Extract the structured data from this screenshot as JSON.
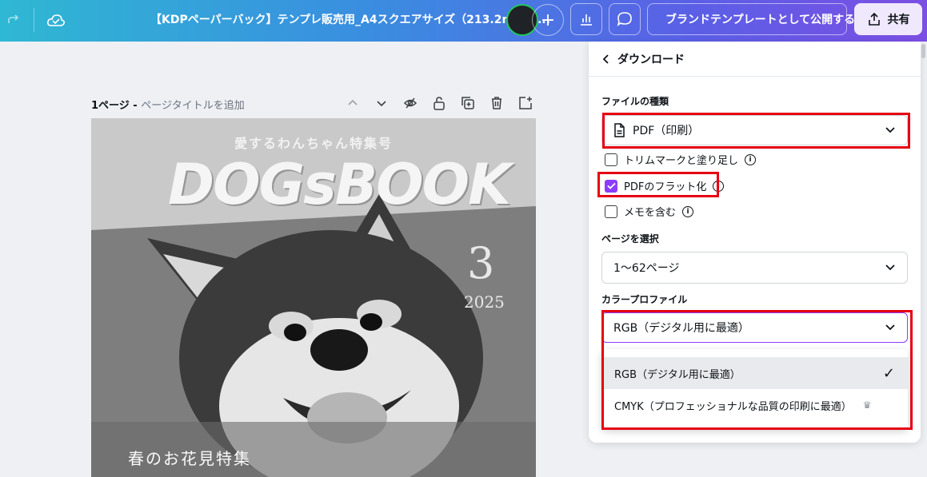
{
  "topbar": {
    "doc_title": "【KDPペーパーバック】テンプレ販売用_A4スクエアサイズ（213.2mm:2...",
    "brand_template_label": "ブランドテンプレートとして公開する",
    "share_label": "共有",
    "plus_label": "+",
    "icons": [
      "redo-icon",
      "cloud-saved-icon",
      "analytics-icon",
      "comment-icon",
      "brand-template-icon",
      "share-icon"
    ]
  },
  "page": {
    "number_label": "1ページ - ",
    "title_placeholder": "ページタイトルを追加"
  },
  "canvas": {
    "subtitle": "愛するわんちゃん特集号",
    "title": "DOGsBOOK",
    "issue_number": "3",
    "year": "2025",
    "caption": "春のお花見特集"
  },
  "panel": {
    "header": "ダウンロード",
    "file_type_label": "ファイルの種類",
    "file_type_value": "PDF（印刷）",
    "trim_marks_label": "トリムマークと塗り足し",
    "trim_marks_checked": false,
    "flatten_label": "PDFのフラット化",
    "flatten_checked": true,
    "notes_label": "メモを含む",
    "notes_checked": false,
    "pages_label": "ページを選択",
    "pages_value": "1〜62ページ",
    "color_profile_label": "カラープロファイル",
    "color_profile_value": "RGB（デジタル用に最適）",
    "options": [
      {
        "label": "RGB（デジタル用に最適）",
        "selected": true
      },
      {
        "label": "CMYK（プロフェッショナルな品質の印刷に最適）",
        "selected": false
      }
    ],
    "check_mark": "✓",
    "crown_mark": "♛",
    "accent_color": "#8b3dff",
    "highlight_color": "#e60012"
  }
}
